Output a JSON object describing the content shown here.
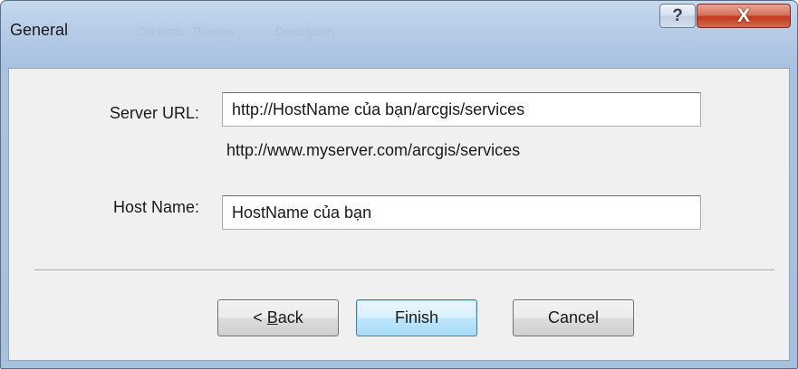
{
  "window": {
    "title": "General",
    "background_tabs": [
      "Contents",
      "Preview",
      "Description"
    ],
    "help_glyph": "?",
    "close_glyph": "X"
  },
  "form": {
    "server_url": {
      "label": "Server URL:",
      "value": "http://HostName của bạn/arcgis/services",
      "hint": "http://www.myserver.com/arcgis/services"
    },
    "host_name": {
      "label": "Host Name:",
      "value": "HostName của bạn"
    }
  },
  "buttons": {
    "back": {
      "prefix": "< ",
      "mnemonic": "B",
      "rest": "ack"
    },
    "finish": "Finish",
    "cancel": "Cancel"
  },
  "colors": {
    "title_bar": "#b7cde8",
    "client_bg": "#f0f0f0",
    "close_button": "#c2391e",
    "default_button": "#a7d9f5"
  }
}
